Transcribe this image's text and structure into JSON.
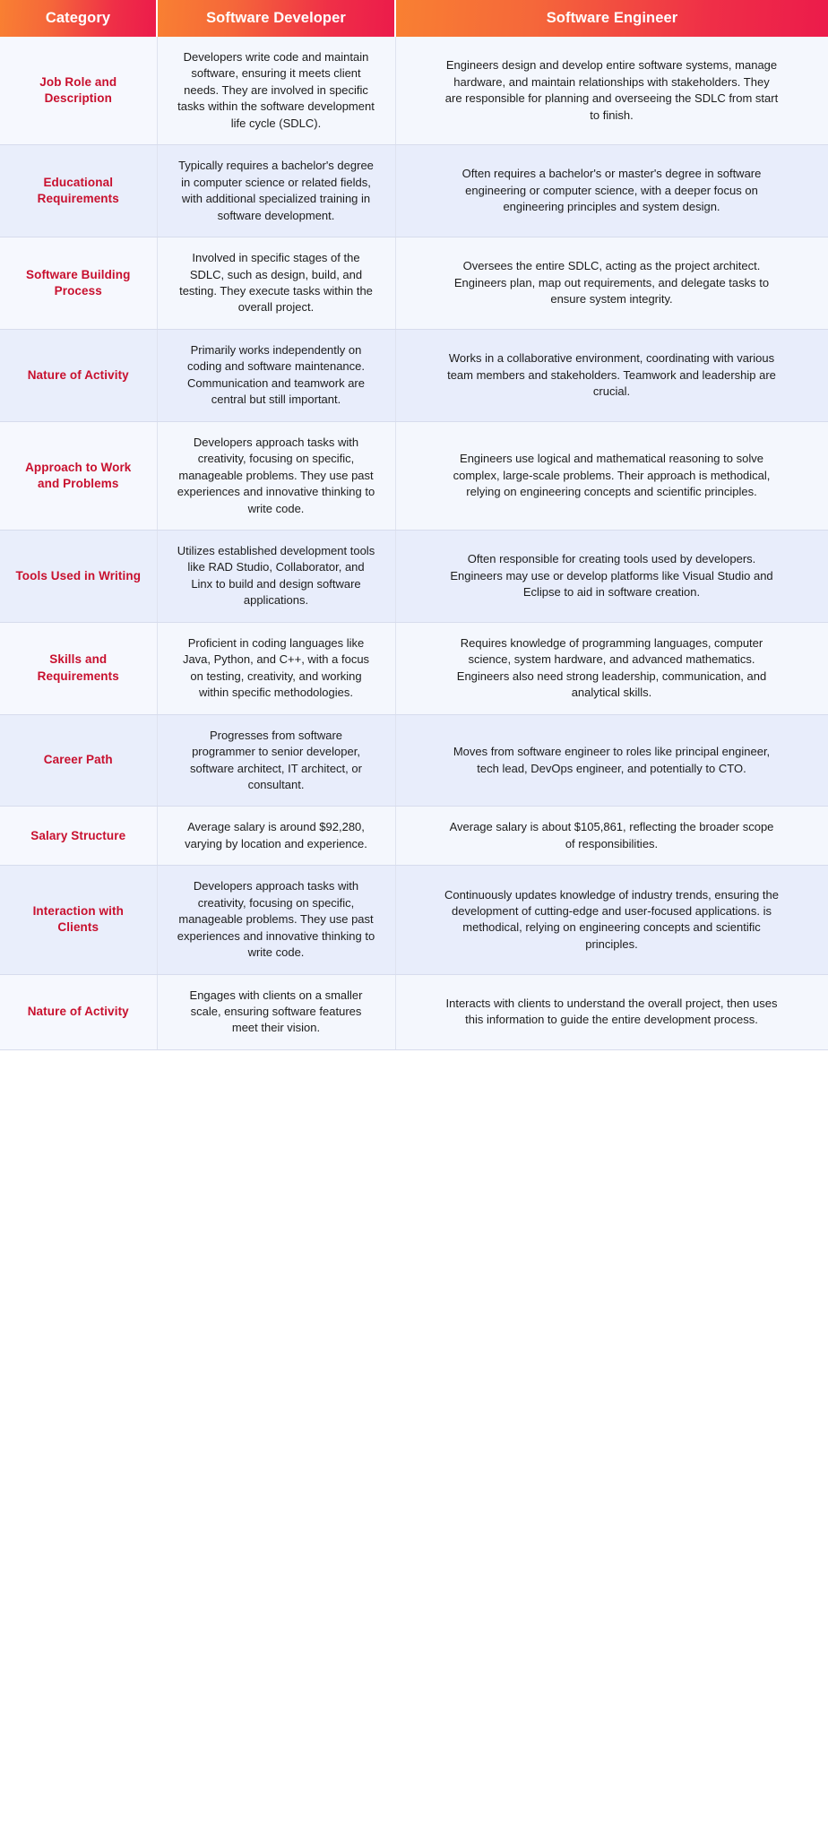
{
  "table": {
    "headers": [
      {
        "label": "Category",
        "key": "category"
      },
      {
        "label": "Software Developer",
        "key": "developer"
      },
      {
        "label": "Software Engineer",
        "key": "engineer"
      }
    ],
    "colors": {
      "header_gradient_start": "#f98032",
      "header_gradient_end": "#ec1b4b",
      "header_text": "#ffffff",
      "category_text": "#c8102e",
      "body_text": "#1c1c1c",
      "row_light_bg": "#f4f7fd",
      "row_dark_bg": "#e8edfb",
      "border": "#d7dced"
    },
    "rows": [
      {
        "category": "Job Role and Description",
        "developer": "Developers write code and maintain software, ensuring it meets client needs. They are involved in specific tasks within the software development life cycle (SDLC).",
        "engineer": "Engineers design and develop entire software systems, manage hardware, and maintain relationships with stakeholders. They are responsible for planning and overseeing the SDLC from start to finish."
      },
      {
        "category": "Educational Requirements",
        "developer": "Typically requires a bachelor's degree in computer science or related fields, with additional specialized training in software development.",
        "engineer": "Often requires a bachelor's or master's degree in software engineering or computer science, with a deeper focus on engineering principles and system design."
      },
      {
        "category": "Software Building Process",
        "developer": "Involved in specific stages of the SDLC, such as design, build, and testing. They execute tasks within the overall project.",
        "engineer": "Oversees the entire SDLC, acting as the project architect. Engineers plan, map out requirements, and delegate tasks to ensure system integrity."
      },
      {
        "category": "Nature of Activity",
        "developer": "Primarily works independently on coding and software maintenance. Communication and teamwork are  central but still important.",
        "engineer": "Works in a collaborative environment, coordinating with various team members and stakeholders. Teamwork and leadership are crucial."
      },
      {
        "category": "Approach to Work and Problems",
        "developer": "Developers approach tasks with creativity, focusing on specific, manageable problems. They use past experiences and innovative thinking to write code.",
        "engineer": "Engineers use logical and mathematical reasoning to solve complex, large-scale problems. Their approach is methodical, relying on engineering concepts and scientific principles."
      },
      {
        "category": "Tools Used in Writing",
        "developer": "Utilizes established development tools like RAD Studio, Collaborator, and Linx to build and design software applications.",
        "engineer": "Often responsible for creating tools used by developers. Engineers may use or develop platforms like Visual Studio and Eclipse to aid in software creation."
      },
      {
        "category": "Skills and Requirements",
        "developer": "Proficient in coding languages like Java, Python, and C++, with a focus on testing, creativity, and working within specific methodologies.",
        "engineer": "Requires knowledge of programming languages, computer science, system hardware, and advanced mathematics. Engineers also need strong leadership, communication, and analytical skills."
      },
      {
        "category": "Career Path",
        "developer": "Progresses from software programmer to senior developer, software architect, IT architect, or consultant.",
        "engineer": "Moves from software engineer to roles like principal engineer, tech lead, DevOps engineer, and potentially to CTO."
      },
      {
        "category": "Salary Structure",
        "developer": "Average salary is around $92,280, varying by location and experience.",
        "engineer": "Average salary is about $105,861, reflecting the broader scope of responsibilities."
      },
      {
        "category": "Interaction with Clients",
        "developer": "Developers approach tasks with creativity, focusing on specific, manageable problems. They use past experiences and innovative thinking to write code.",
        "engineer": "Continuously updates knowledge of industry trends, ensuring the development of cutting-edge and user-focused applications. is methodical, relying on engineering concepts and scientific principles."
      },
      {
        "category": "Nature of Activity",
        "developer": "Engages with clients on a smaller scale, ensuring software features meet their vision.",
        "engineer": "Interacts with clients to understand the overall project, then uses this information to guide the entire development process."
      }
    ]
  }
}
